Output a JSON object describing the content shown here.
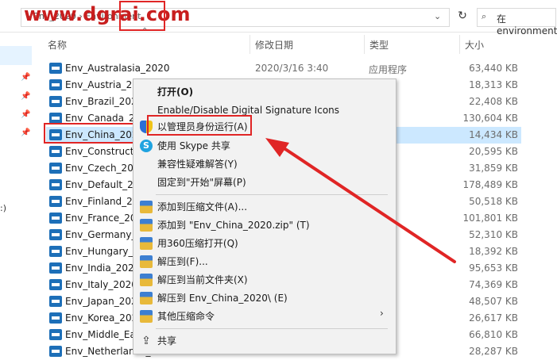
{
  "watermark": "www.dgrai.com",
  "address": {
    "path": "› Env_2020 › Environment",
    "search_placeholder": "在 environment"
  },
  "columns": {
    "name": "名称",
    "date": "修改日期",
    "type": "类型",
    "size": "大小"
  },
  "files": [
    {
      "name": "Env_Australasia_2020",
      "date": "2020/3/16 3:40",
      "type": "应用程序",
      "size": "63,440 KB"
    },
    {
      "name": "Env_Austria_2020",
      "date": "",
      "type": "",
      "size": "18,313 KB"
    },
    {
      "name": "Env_Brazil_2020",
      "date": "",
      "type": "",
      "size": "22,408 KB"
    },
    {
      "name": "Env_Canada_2020",
      "date": "",
      "type": "",
      "size": "130,604 KB"
    },
    {
      "name": "Env_China_2020",
      "date": "",
      "type": "程序",
      "size": "14,434 KB"
    },
    {
      "name": "Env_Construction_2020",
      "date": "",
      "type": "",
      "size": "20,595 KB"
    },
    {
      "name": "Env_Czech_2020",
      "date": "",
      "type": "",
      "size": "31,859 KB"
    },
    {
      "name": "Env_Default_2020",
      "date": "",
      "type": "",
      "size": "178,489 KB"
    },
    {
      "name": "Env_Finland_2020",
      "date": "",
      "type": "",
      "size": "50,518 KB"
    },
    {
      "name": "Env_France_2020",
      "date": "",
      "type": "",
      "size": "101,801 KB"
    },
    {
      "name": "Env_Germany_2020",
      "date": "",
      "type": "",
      "size": "52,310 KB"
    },
    {
      "name": "Env_Hungary_2020",
      "date": "",
      "type": "",
      "size": "18,392 KB"
    },
    {
      "name": "Env_India_2020",
      "date": "",
      "type": "",
      "size": "95,653 KB"
    },
    {
      "name": "Env_Italy_2020",
      "date": "",
      "type": "",
      "size": "74,369 KB"
    },
    {
      "name": "Env_Japan_2020",
      "date": "",
      "type": "",
      "size": "48,507 KB"
    },
    {
      "name": "Env_Korea_2020",
      "date": "",
      "type": "",
      "size": "26,617 KB"
    },
    {
      "name": "Env_Middle_East_2020",
      "date": "",
      "type": "",
      "size": "66,810 KB"
    },
    {
      "name": "Env_Netherlands_2020",
      "date": "",
      "type": "",
      "size": "28,287 KB"
    }
  ],
  "menu": {
    "open": "打开(O)",
    "signature": "Enable/Disable Digital Signature Icons",
    "run_as_admin": "以管理员身份运行(A)",
    "skype_share": "使用 Skype 共享",
    "compat": "兼容性疑难解答(Y)",
    "pin_start": "固定到\"开始\"屏幕(P)",
    "add_archive": "添加到压缩文件(A)...",
    "add_zip": "添加到 \"Env_China_2020.zip\" (T)",
    "compress_360": "用360压缩打开(Q)",
    "extract_to": "解压到(F)...",
    "extract_here": "解压到当前文件夹(X)",
    "extract_folder": "解压到 Env_China_2020\\ (E)",
    "other_cmds": "其他压缩命令",
    "share": "共享"
  },
  "left_pane": {
    "fragment": ":)"
  },
  "colors": {
    "accent_red": "#e02525",
    "selection": "#cce8ff",
    "menu_bg": "#f2f2f2"
  }
}
